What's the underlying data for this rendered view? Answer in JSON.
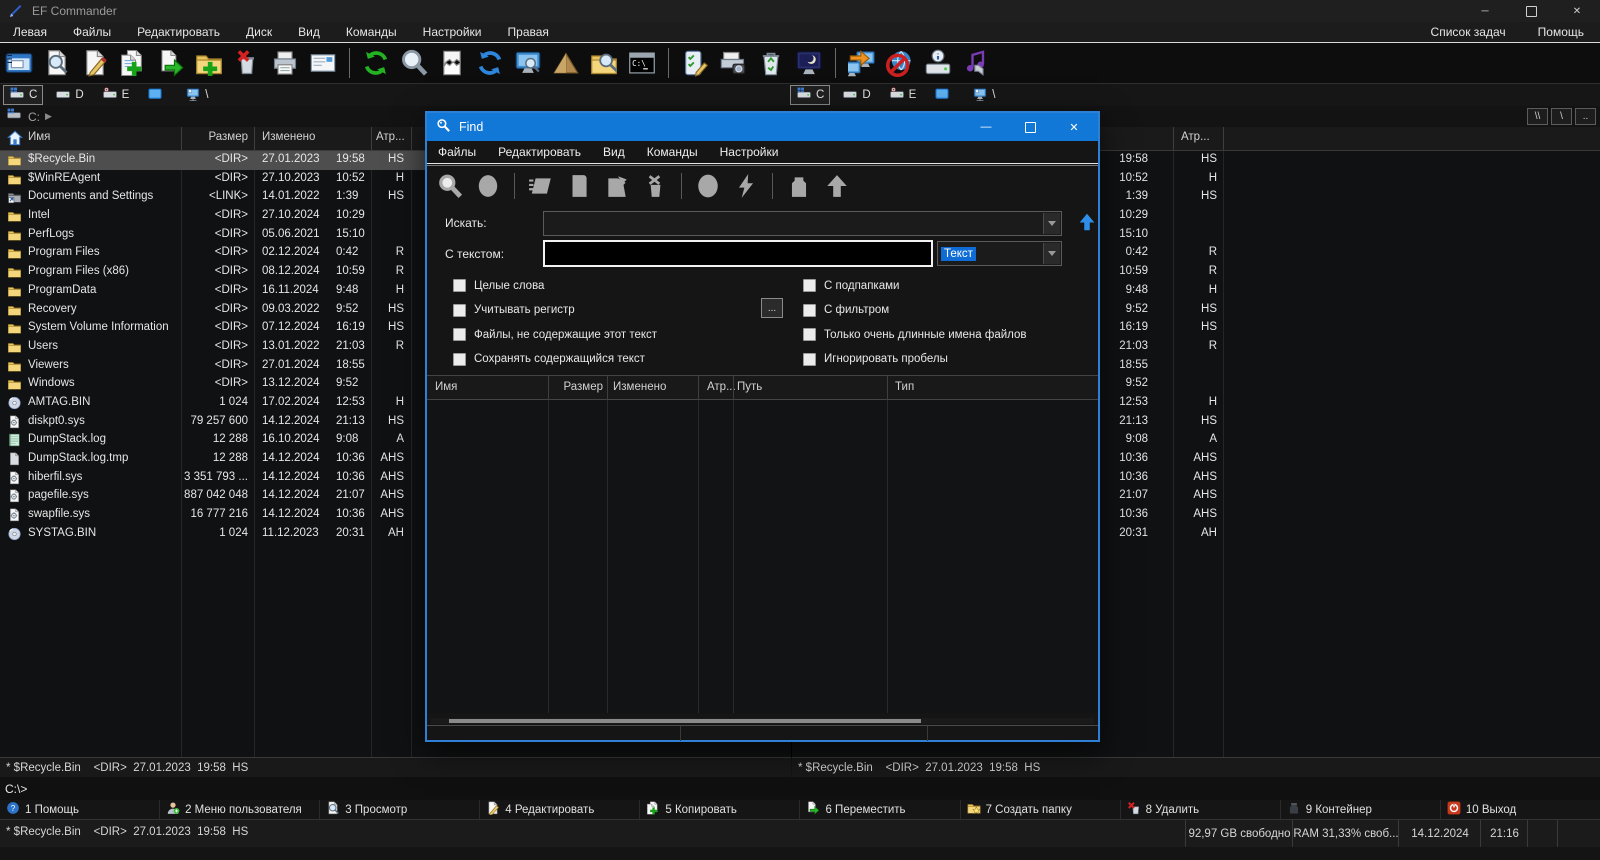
{
  "window": {
    "title": "EF Commander",
    "controls": [
      {
        "name": "minimize-button",
        "glyph": "minimize"
      },
      {
        "name": "maximize-button",
        "glyph": "maximize"
      },
      {
        "name": "close-button",
        "glyph": "close"
      }
    ]
  },
  "menubar": {
    "left": [
      "Левая",
      "Файлы",
      "Редактировать",
      "Диск",
      "Вид",
      "Команды",
      "Настройки",
      "Правая"
    ],
    "right": [
      "Список задач",
      "Помощь"
    ]
  },
  "toolbar": {
    "groups": [
      [
        "new-session-icon",
        "view-file-icon",
        "edit-file-icon",
        "copy-files-icon",
        "move-files-icon",
        "new-folder-icon",
        "delete-icon",
        "print-icon",
        "email-icon"
      ],
      [
        "refresh-icon",
        "search-icon",
        "compare-icon",
        "sync-icon",
        "quick-view-icon",
        "pack-pyramid-icon",
        "find-files-icon",
        "terminal-icon"
      ],
      [
        "task-edit-icon",
        "scan-icon",
        "recycle-bin-icon",
        "screensaver-icon"
      ],
      [
        "net-connect-icon",
        "net-disconnect-icon",
        "drive-info-icon",
        "multimedia-icon"
      ]
    ]
  },
  "drivebar": {
    "drives": [
      {
        "letter": "C",
        "icon": "drive-c-icon",
        "selected": true
      },
      {
        "letter": "D",
        "icon": "drive-d-icon",
        "selected": false
      },
      {
        "letter": "E",
        "icon": "drive-e-icon",
        "selected": false
      }
    ],
    "extras": [
      {
        "icon": "desktop-icon",
        "label": ""
      },
      {
        "icon": "network-icon",
        "label": "\\"
      }
    ]
  },
  "left_panel": {
    "path": "C:",
    "columns": [
      "Имя",
      "Размер",
      "Изменено",
      "Атр..."
    ],
    "selected_index": 0,
    "status": "* $Recycle.Bin    <DIR>  27.01.2023  19:58  HS"
  },
  "right_panel": {
    "nav_buttons": [
      "\\\\",
      "\\",
      ".."
    ],
    "attr_column": "Атр...",
    "status": "* $Recycle.Bin    <DIR>  27.01.2023  19:58  HS"
  },
  "files": [
    {
      "name": "$Recycle.Bin",
      "size": "<DIR>",
      "date": "27.01.2023",
      "time": "19:58",
      "attr": "HS",
      "icon": "folder-icon"
    },
    {
      "name": "$WinREAgent",
      "size": "<DIR>",
      "date": "27.10.2023",
      "time": "10:52",
      "attr": "H",
      "icon": "folder-icon"
    },
    {
      "name": "Documents and Settings",
      "size": "<LINK>",
      "date": "14.01.2022",
      "time": "1:39",
      "attr": "HS",
      "icon": "folder-link-icon"
    },
    {
      "name": "Intel",
      "size": "<DIR>",
      "date": "27.10.2024",
      "time": "10:29",
      "attr": "",
      "icon": "folder-icon"
    },
    {
      "name": "PerfLogs",
      "size": "<DIR>",
      "date": "05.06.2021",
      "time": "15:10",
      "attr": "",
      "icon": "folder-icon"
    },
    {
      "name": "Program Files",
      "size": "<DIR>",
      "date": "02.12.2024",
      "time": "0:42",
      "attr": "R",
      "icon": "folder-icon"
    },
    {
      "name": "Program Files (x86)",
      "size": "<DIR>",
      "date": "08.12.2024",
      "time": "10:59",
      "attr": "R",
      "icon": "folder-icon"
    },
    {
      "name": "ProgramData",
      "size": "<DIR>",
      "date": "16.11.2024",
      "time": "9:48",
      "attr": "H",
      "icon": "folder-icon"
    },
    {
      "name": "Recovery",
      "size": "<DIR>",
      "date": "09.03.2022",
      "time": "9:52",
      "attr": "HS",
      "icon": "folder-icon"
    },
    {
      "name": "System Volume Information",
      "size": "<DIR>",
      "date": "07.12.2024",
      "time": "16:19",
      "attr": "HS",
      "icon": "folder-icon"
    },
    {
      "name": "Users",
      "size": "<DIR>",
      "date": "13.01.2022",
      "time": "21:03",
      "attr": "R",
      "icon": "folder-icon"
    },
    {
      "name": "Viewers",
      "size": "<DIR>",
      "date": "27.01.2024",
      "time": "18:55",
      "attr": "",
      "icon": "folder-icon"
    },
    {
      "name": "Windows",
      "size": "<DIR>",
      "date": "13.12.2024",
      "time": "9:52",
      "attr": "",
      "icon": "folder-icon"
    },
    {
      "name": "AMTAG.BIN",
      "size": "1 024",
      "date": "17.02.2024",
      "time": "12:53",
      "attr": "H",
      "icon": "disc-icon"
    },
    {
      "name": "diskpt0.sys",
      "size": "79 257 600",
      "date": "14.12.2024",
      "time": "21:13",
      "attr": "HS",
      "icon": "sys-icon"
    },
    {
      "name": "DumpStack.log",
      "size": "12 288",
      "date": "16.10.2024",
      "time": "9:08",
      "attr": "A",
      "icon": "log-icon"
    },
    {
      "name": "DumpStack.log.tmp",
      "size": "12 288",
      "date": "14.12.2024",
      "time": "10:36",
      "attr": "AHS",
      "icon": "doc-icon"
    },
    {
      "name": "hiberfil.sys",
      "size": "3 351 793 ...",
      "date": "14.12.2024",
      "time": "10:36",
      "attr": "AHS",
      "icon": "sys-icon"
    },
    {
      "name": "pagefile.sys",
      "size": "887 042 048",
      "date": "14.12.2024",
      "time": "21:07",
      "attr": "AHS",
      "icon": "sys-icon"
    },
    {
      "name": "swapfile.sys",
      "size": "16 777 216",
      "date": "14.12.2024",
      "time": "10:36",
      "attr": "AHS",
      "icon": "sys-icon"
    },
    {
      "name": "SYSTAG.BIN",
      "size": "1 024",
      "date": "11.12.2023",
      "time": "20:31",
      "attr": "AH",
      "icon": "disc-icon"
    }
  ],
  "find_dialog": {
    "title": "Find",
    "menu": [
      "Файлы",
      "Редактировать",
      "Вид",
      "Команды",
      "Настройки"
    ],
    "toolbar_groups": [
      [
        "find-search-icon",
        "find-oval-icon"
      ],
      [
        "find-panel-icon",
        "find-doc-icon",
        "find-folder-icon",
        "find-trash-icon"
      ],
      [
        "find-result-icon",
        "find-bolt-icon"
      ],
      [
        "find-jar-icon",
        "find-up-icon"
      ]
    ],
    "fields": {
      "search_label": "Искать:",
      "search_value": "",
      "text_label": "С текстом:",
      "text_value": "",
      "text_type_value": "Текст"
    },
    "more_button": "...",
    "checkboxes_left": [
      "Целые слова",
      "Учитывать регистр",
      "Файлы, не содержащие этот текст",
      "Сохранять содержащийся текст"
    ],
    "checkboxes_right": [
      "С подпапками",
      "С фильтром",
      "Только очень длинные имена файлов",
      "Игнорировать пробелы"
    ],
    "result_columns": [
      "Имя",
      "Размер",
      "Изменено",
      "Атр...",
      "Путь",
      "Тип"
    ]
  },
  "command_line": {
    "prompt": "C:\\>"
  },
  "function_bar": [
    {
      "key": "1",
      "label": "Помощь",
      "icon": "fn-help-icon"
    },
    {
      "key": "2",
      "label": "Меню пользователя",
      "icon": "fn-user-icon"
    },
    {
      "key": "3",
      "label": "Просмотр",
      "icon": "fn-view-icon"
    },
    {
      "key": "4",
      "label": "Редактировать",
      "icon": "fn-edit-icon"
    },
    {
      "key": "5",
      "label": "Копировать",
      "icon": "fn-copy-icon"
    },
    {
      "key": "6",
      "label": "Переместить",
      "icon": "fn-move-icon"
    },
    {
      "key": "7",
      "label": "Создать папку",
      "icon": "fn-mkdir-icon"
    },
    {
      "key": "8",
      "label": "Удалить",
      "icon": "fn-delete-icon"
    },
    {
      "key": "9",
      "label": "Контейнер",
      "icon": "fn-container-icon"
    },
    {
      "key": "10",
      "label": "Выход",
      "icon": "fn-exit-icon"
    }
  ],
  "status_bar": {
    "left": "* $Recycle.Bin    <DIR>  27.01.2023  19:58  HS",
    "cells": [
      "92,97 GB свободно",
      "RAM 31,33% своб...",
      "14.12.2024",
      "21:16",
      "",
      ""
    ]
  },
  "colors": {
    "accent_blue": "#1278d7",
    "selection_gray": "#4e4e4e",
    "highlight_blue": "#0e6cd4"
  }
}
